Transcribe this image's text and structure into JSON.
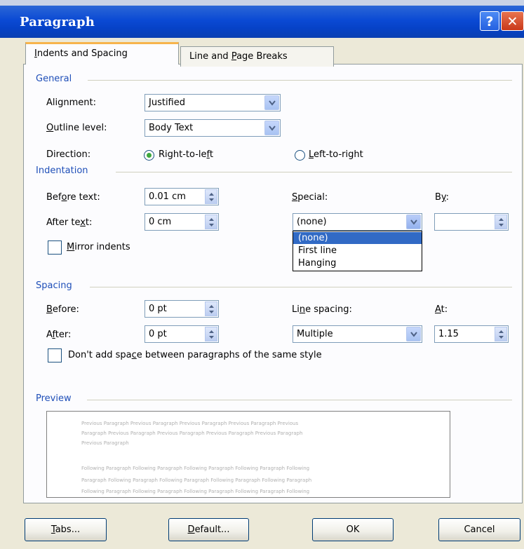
{
  "window": {
    "title": "Paragraph",
    "help_glyph": "?",
    "close_glyph": "✕"
  },
  "tabs": [
    {
      "label_pre": "",
      "label_key": "I",
      "label_post": "ndents and Spacing",
      "active": true
    },
    {
      "label_pre": "Line and ",
      "label_key": "P",
      "label_post": "age Breaks",
      "active": false
    }
  ],
  "general": {
    "header": "General",
    "alignment": {
      "label_pre": "Alignment:",
      "label_key": "",
      "label_post": "",
      "value": "Justified"
    },
    "outline": {
      "label_pre": "",
      "label_key": "O",
      "label_post": "utline level:",
      "value": "Body Text"
    },
    "direction": {
      "label": "Direction:",
      "rtl": {
        "label_pre": "Right-to-le",
        "label_key": "f",
        "label_post": "t",
        "selected": true
      },
      "ltr": {
        "label_pre": "",
        "label_key": "L",
        "label_post": "eft-to-right",
        "selected": false
      }
    }
  },
  "indentation": {
    "header": "Indentation",
    "before": {
      "label_pre": "Bef",
      "label_key": "o",
      "label_post": "re text:",
      "value": "0.01 cm"
    },
    "after": {
      "label_pre": "After te",
      "label_key": "x",
      "label_post": "t:",
      "value": "0 cm"
    },
    "special": {
      "label_pre": "",
      "label_key": "S",
      "label_post": "pecial:",
      "value": "(none)"
    },
    "by": {
      "label_pre": "B",
      "label_key": "y",
      "label_post": ":",
      "value": ""
    },
    "mirror": {
      "label_pre": "",
      "label_key": "M",
      "label_post": "irror indents",
      "checked": false
    },
    "special_options": [
      "(none)",
      "First line",
      "Hanging"
    ]
  },
  "spacing": {
    "header": "Spacing",
    "before": {
      "label_pre": "",
      "label_key": "B",
      "label_post": "efore:",
      "value": "0 pt"
    },
    "after": {
      "label_pre": "A",
      "label_key": "f",
      "label_post": "ter:",
      "value": "0 pt"
    },
    "line": {
      "label_pre": "Li",
      "label_key": "n",
      "label_post": "e spacing:",
      "value": "Multiple"
    },
    "at": {
      "label_pre": "",
      "label_key": "A",
      "label_post": "t:",
      "value": "1.15"
    },
    "dont_add": {
      "label_pre": "Don't add spa",
      "label_key": "c",
      "label_post": "e between paragraphs of the same style",
      "checked": false
    }
  },
  "preview": {
    "header": "Preview",
    "prev_lines": [
      "Previous Paragraph Previous Paragraph Previous Paragraph Previous Paragraph Previous",
      "Paragraph Previous Paragraph Previous Paragraph Previous Paragraph Previous Paragraph",
      "Previous Paragraph"
    ],
    "follow_lines": [
      "Following Paragraph Following Paragraph Following Paragraph Following Paragraph Following",
      "Paragraph Following Paragraph Following Paragraph Following Paragraph Following Paragraph",
      "Following Paragraph Following Paragraph Following Paragraph Following Paragraph Following"
    ]
  },
  "buttons": {
    "tabs": {
      "label_pre": "",
      "label_key": "T",
      "label_post": "abs..."
    },
    "default": {
      "label_pre": "",
      "label_key": "D",
      "label_post": "efault..."
    },
    "ok": {
      "label": "OK"
    },
    "cancel": {
      "label": "Cancel"
    }
  },
  "colors": {
    "titlebar": "#0b4ad4",
    "group_header": "#1f4fb8",
    "selection": "#316ac5",
    "radio_dot": "#3ea83e"
  }
}
